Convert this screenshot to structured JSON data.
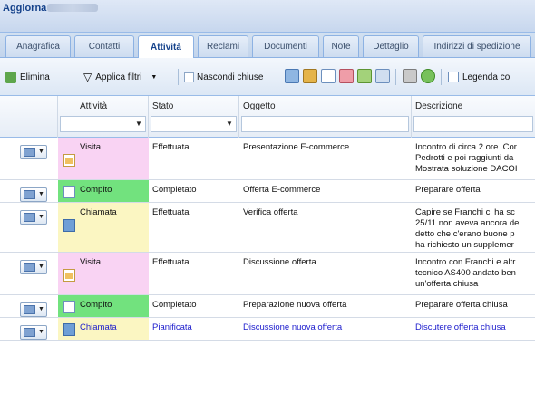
{
  "window": {
    "title": "Aggiorna"
  },
  "tabs": [
    "Anagrafica",
    "Contatti",
    "Attività",
    "Reclami",
    "Documenti",
    "Note",
    "Dettaglio",
    "Indirizzi di spedizione"
  ],
  "active_tab": "Attività",
  "toolbar": {
    "delete_label": "Elimina",
    "filter_label": "Applica filtri",
    "hide_closed_label": "Nascondi chiuse",
    "legend_label": "Legenda co"
  },
  "columns": {
    "activity": "Attività",
    "status": "Stato",
    "subject": "Oggetto",
    "description": "Descrizione"
  },
  "rows": [
    {
      "type": "Visita",
      "status": "Effettuata",
      "subject": "Presentazione E-commerce",
      "description": [
        "Incontro di circa 2 ore. Cor",
        "Pedrotti e poi raggiunti da",
        "Mostrata soluzione DACOI"
      ],
      "color": "#f9d3f3",
      "icon": "calendar-icon"
    },
    {
      "type": "Compito",
      "status": "Completato",
      "subject": "Offerta E-commerce",
      "description": [
        "Preparare offerta"
      ],
      "color": "#72e27e",
      "icon": "document-icon"
    },
    {
      "type": "Chiamata",
      "status": "Effettuata",
      "subject": "Verifica offerta",
      "description": [
        "Capire se Franchi ci ha sc",
        "25/11 non aveva ancora de",
        "detto che c'erano buone p",
        "ha richiesto un supplemer"
      ],
      "color": "#fbf6c2",
      "icon": "phone-icon"
    },
    {
      "type": "Visita",
      "status": "Effettuata",
      "subject": "Discussione offerta",
      "description": [
        "Incontro con Franchi e altr",
        "tecnico AS400 andato ben",
        "un'offerta chiusa"
      ],
      "color": "#f9d3f3",
      "icon": "calendar-icon"
    },
    {
      "type": "Compito",
      "status": "Completato",
      "subject": "Preparazione nuova offerta",
      "description": [
        "Preparare offerta chiusa"
      ],
      "color": "#72e27e",
      "icon": "document-icon"
    },
    {
      "type": "Chiamata",
      "status": "Pianificata",
      "subject": "Discussione nuova offerta",
      "description": [
        "Discutere offerta chiusa"
      ],
      "color": "#fbf6c2",
      "icon": "phone-icon",
      "highlight": "#1a1acc"
    }
  ]
}
